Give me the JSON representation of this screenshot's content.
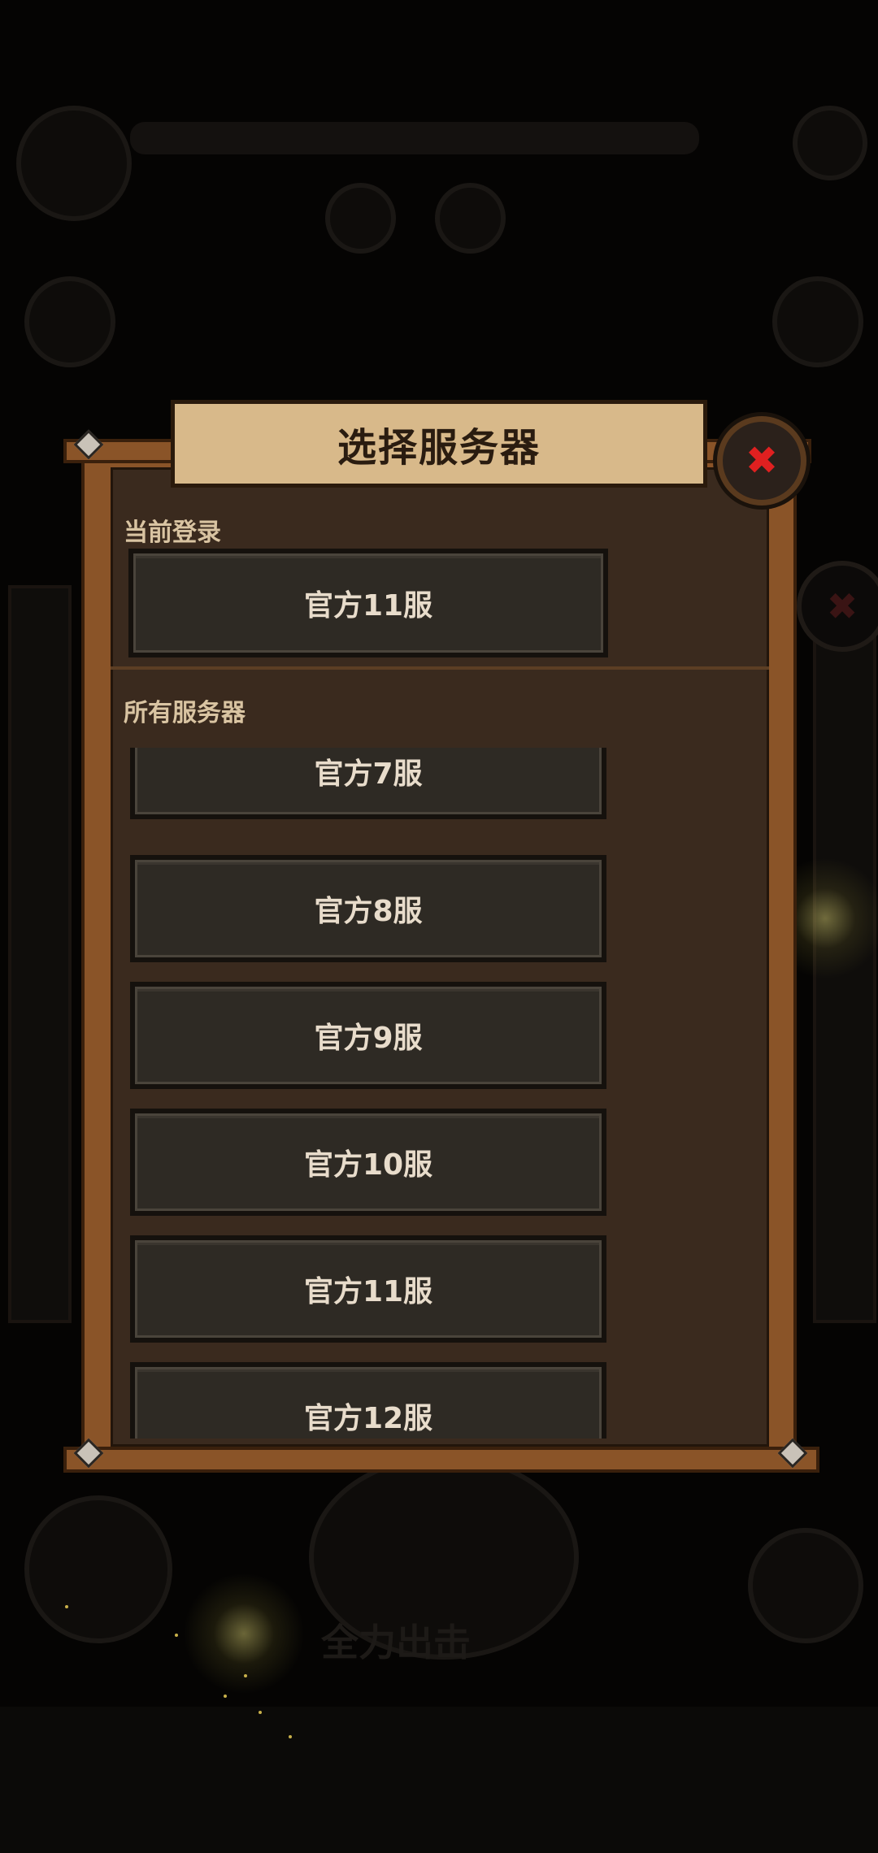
{
  "dialog": {
    "title": "选择服务器",
    "current_section_label": "当前登录",
    "all_section_label": "所有服务器",
    "current_server": "官方11服",
    "close_icon": "close-icon",
    "close_color": "#e02020"
  },
  "servers": [
    {
      "label": "官方7服"
    },
    {
      "label": "官方8服"
    },
    {
      "label": "官方9服"
    },
    {
      "label": "官方10服"
    },
    {
      "label": "官方11服"
    },
    {
      "label": "官方12服"
    }
  ],
  "background": {
    "main_button": "全力出击"
  },
  "colors": {
    "panel_wood": "#8a5428",
    "panel_inner": "#3a2a1e",
    "banner": "#d8b98a",
    "button": "#2e2a24",
    "text_light": "#e8dccb"
  }
}
